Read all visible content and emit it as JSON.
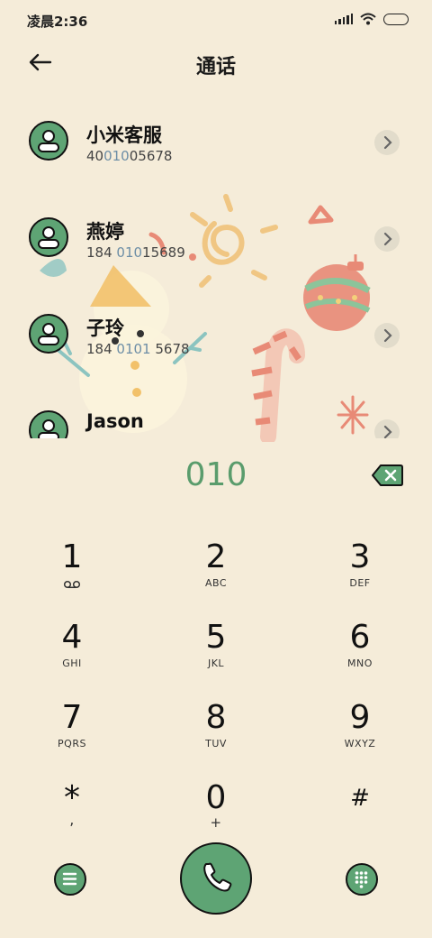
{
  "status_bar": {
    "time": "凌晨2:36"
  },
  "header": {
    "title": "通话"
  },
  "contacts": [
    {
      "name": "小米客服",
      "number_parts": [
        "40",
        "010",
        "05678"
      ]
    },
    {
      "name": "燕婷",
      "number_parts": [
        "184 ",
        "010",
        "15689"
      ]
    },
    {
      "name": "子玲",
      "number_parts": [
        "184 ",
        "0101",
        " 5678"
      ]
    },
    {
      "name": "Jason",
      "number_parts": [
        "",
        "",
        ""
      ]
    }
  ],
  "dialer": {
    "dialed_number": "010"
  },
  "keypad": [
    {
      "digit": "1",
      "letters": ""
    },
    {
      "digit": "2",
      "letters": "ABC"
    },
    {
      "digit": "3",
      "letters": "DEF"
    },
    {
      "digit": "4",
      "letters": "GHI"
    },
    {
      "digit": "5",
      "letters": "JKL"
    },
    {
      "digit": "6",
      "letters": "MNO"
    },
    {
      "digit": "7",
      "letters": "PQRS"
    },
    {
      "digit": "8",
      "letters": "TUV"
    },
    {
      "digit": "9",
      "letters": "WXYZ"
    },
    {
      "digit": "*",
      "letters": ","
    },
    {
      "digit": "0",
      "letters": "+"
    },
    {
      "digit": "#",
      "letters": ""
    }
  ],
  "icons": {
    "back": "arrow-left-icon",
    "voicemail": "voicemail-icon",
    "menu": "menu-icon",
    "call": "phone-icon",
    "dialpad": "dialpad-icon",
    "backspace": "backspace-icon"
  },
  "colors": {
    "background": "#f5ecd9",
    "accent": "#5ea474",
    "dialed_text": "#5a9c6c",
    "highlight": "#6d8ea6"
  }
}
